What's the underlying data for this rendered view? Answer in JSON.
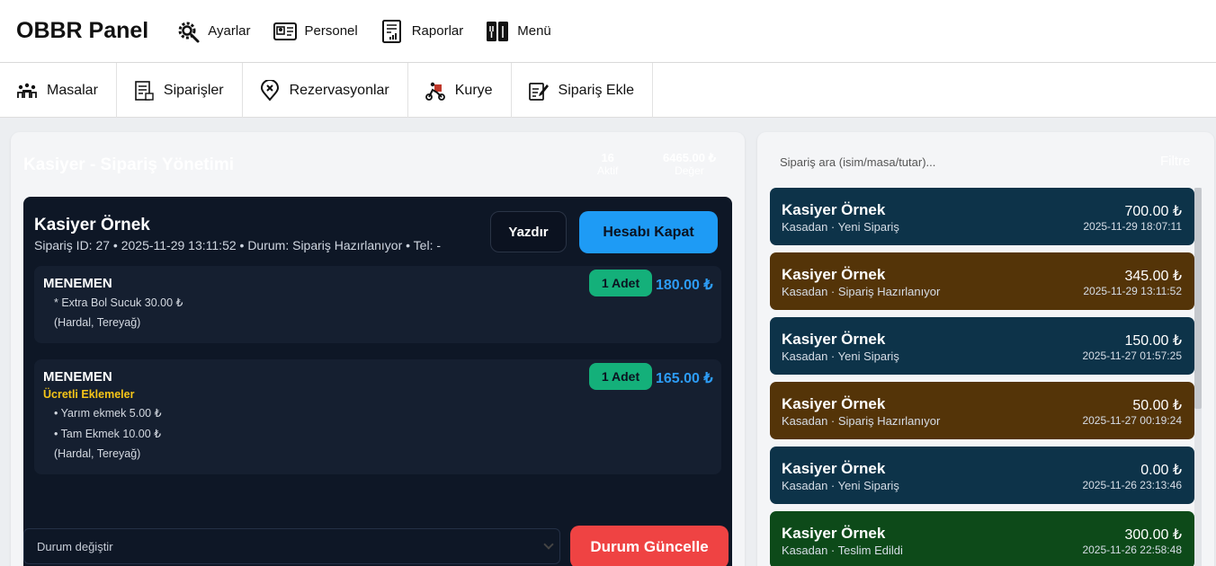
{
  "app": {
    "brand": "OBBR Panel"
  },
  "topnav": [
    {
      "label": "Ayarlar",
      "icon": "gear-icon"
    },
    {
      "label": "Personel",
      "icon": "id-card-icon"
    },
    {
      "label": "Raporlar",
      "icon": "report-icon"
    },
    {
      "label": "Menü",
      "icon": "menu-book-icon"
    }
  ],
  "tabs": [
    {
      "label": "Masalar",
      "icon": "tables-icon"
    },
    {
      "label": "Siparişler",
      "icon": "receipt-icon"
    },
    {
      "label": "Rezervasyonlar",
      "icon": "location-pin-icon"
    },
    {
      "label": "Kurye",
      "icon": "courier-icon"
    },
    {
      "label": "Sipariş Ekle",
      "icon": "add-order-icon"
    }
  ],
  "cashier": {
    "title": "Kasiyer - Sipariş Yönetimi",
    "stats": [
      {
        "value": "16",
        "label": "Aktif"
      },
      {
        "value": "6465.00 ₺",
        "label": "Değer"
      }
    ]
  },
  "order": {
    "customer": "Kasiyer Örnek",
    "meta": "Sipariş ID: 27 • 2025-11-29 13:11:52 • Durum: Sipariş Hazırlanıyor • Tel: -",
    "print_label": "Yazdır",
    "close_label": "Hesabı Kapat",
    "items": [
      {
        "name": "MENEMEN",
        "qty": "1 Adet",
        "price": "180.00 ₺",
        "extra": "* Extra Bol Sucuk 30.00 ₺",
        "note": "(Hardal, Tereyağ)"
      },
      {
        "name": "MENEMEN",
        "qty": "1 Adet",
        "price": "165.00 ₺",
        "paid_label": "Ücretli Eklemeler",
        "extras": [
          "• Yarım ekmek 5.00 ₺",
          "• Tam Ekmek 10.00 ₺"
        ],
        "note": "(Hardal, Tereyağ)"
      }
    ],
    "status_select": "Durum değiştir",
    "update_label": "Durum Güncelle"
  },
  "orders_list": {
    "search_placeholder": "Sipariş ara (isim/masa/tutar)...",
    "filter_label": "Filtre",
    "cards": [
      {
        "name": "Kasiyer Örnek",
        "sub": "Kasadan · Yeni Sipariş",
        "amount": "700.00 ₺",
        "date": "2025-11-29 18:07:11",
        "color": "#0d3349"
      },
      {
        "name": "Kasiyer Örnek",
        "sub": "Kasadan · Sipariş Hazırlanıyor",
        "amount": "345.00 ₺",
        "date": "2025-11-29 13:11:52",
        "color": "#543408"
      },
      {
        "name": "Kasiyer Örnek",
        "sub": "Kasadan · Yeni Sipariş",
        "amount": "150.00 ₺",
        "date": "2025-11-27 01:57:25",
        "color": "#0d3349"
      },
      {
        "name": "Kasiyer Örnek",
        "sub": "Kasadan · Sipariş Hazırlanıyor",
        "amount": "50.00 ₺",
        "date": "2025-11-27 00:19:24",
        "color": "#543408"
      },
      {
        "name": "Kasiyer Örnek",
        "sub": "Kasadan · Yeni Sipariş",
        "amount": "0.00 ₺",
        "date": "2025-11-26 23:13:46",
        "color": "#0d3349"
      },
      {
        "name": "Kasiyer Örnek",
        "sub": "Kasadan · Teslim Edildi",
        "amount": "300.00 ₺",
        "date": "2025-11-26 22:58:48",
        "color": "#0d4a19"
      }
    ]
  }
}
